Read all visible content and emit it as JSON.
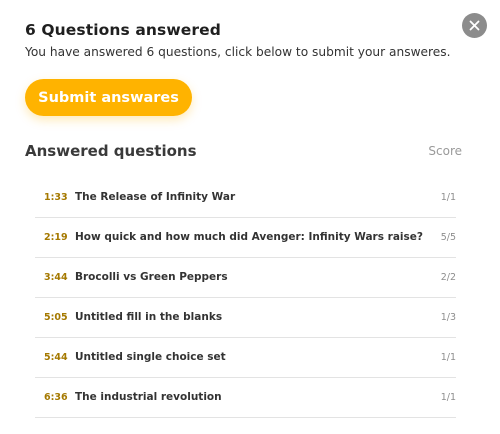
{
  "dialog": {
    "close_icon": "close-icon",
    "heading": "6 Questions answered",
    "subheading": "You have answered 6 questions, click below to submit your answeres.",
    "submit_label": "Submit answares",
    "accent_color": "#ffb300"
  },
  "answered": {
    "title": "Answered questions",
    "score_header": "Score",
    "questions": [
      {
        "time": "1:33",
        "title": "The Release of Infinity War",
        "score": "1/1"
      },
      {
        "time": "2:19",
        "title": "How quick and how much did Avenger: Infinity Wars raise?",
        "score": "5/5"
      },
      {
        "time": "3:44",
        "title": "Brocolli vs Green Peppers",
        "score": "2/2"
      },
      {
        "time": "5:05",
        "title": "Untitled fill in the blanks",
        "score": "1/3"
      },
      {
        "time": "5:44",
        "title": "Untitled single choice set",
        "score": "1/1"
      },
      {
        "time": "6:36",
        "title": "The industrial revolution",
        "score": "1/1"
      }
    ]
  }
}
